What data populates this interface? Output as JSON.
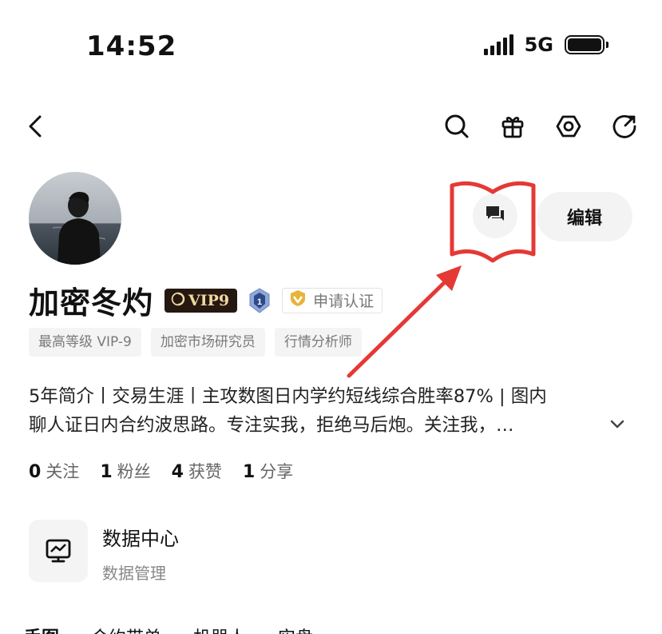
{
  "status_bar": {
    "time": "14:52",
    "network": "5G"
  },
  "profile": {
    "name": "加密冬灼",
    "vip_badge": "VIP9",
    "certify_label": "申请认证",
    "tags": [
      "最高等级 VIP-9",
      "加密市场研究员",
      "行情分析师"
    ],
    "bio_line1": "5年简介丨交易生涯丨主攻数图日内学约短线综合胜率87% | 图内",
    "bio_line2": "聊人证日内合约波思路。专注实我，拒绝马后炮。关注我，…",
    "edit_label": "编辑"
  },
  "stats": [
    {
      "count": "0",
      "label": "关注"
    },
    {
      "count": "1",
      "label": "粉丝"
    },
    {
      "count": "4",
      "label": "获赞"
    },
    {
      "count": "1",
      "label": "分享"
    }
  ],
  "data_center": {
    "title": "数据中心",
    "subtitle": "数据管理"
  },
  "bottom_tabs": [
    "手图",
    "合约带单",
    "机器人",
    "实盘"
  ],
  "icons": {
    "nav": [
      "back-icon",
      "search-icon",
      "gift-icon",
      "settings-icon",
      "share-icon"
    ],
    "actions": [
      "chat-icon",
      "chevron-down-icon",
      "chart-monitor-icon"
    ]
  },
  "colors": {
    "annotation_red": "#e53935",
    "vip_bg": "#241810",
    "vip_text": "#f2d7a2",
    "cert_gold": "#e7b33a"
  }
}
